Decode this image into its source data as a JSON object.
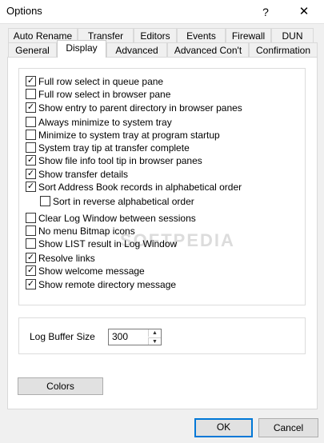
{
  "window": {
    "title": "Options",
    "help": "?",
    "close": "✕"
  },
  "tabs_row1": [
    "Auto Rename",
    "Transfer",
    "Editors",
    "Events",
    "Firewall",
    "DUN"
  ],
  "tabs_row2": [
    "General",
    "Display",
    "Advanced",
    "Advanced Con't",
    "Confirmation"
  ],
  "active_tab": "Display",
  "options": [
    {
      "label": "Full row select in queue pane",
      "checked": true
    },
    {
      "label": "Full row select in browser pane",
      "checked": false
    },
    {
      "label": "Show entry to parent directory in browser panes",
      "checked": true
    },
    {
      "label": "Always minimize to system tray",
      "checked": false
    },
    {
      "label": "Minimize to system tray at program startup",
      "checked": false
    },
    {
      "label": "System tray tip at transfer complete",
      "checked": false
    },
    {
      "label": "Show file info tool tip in browser panes",
      "checked": true
    },
    {
      "label": "Show transfer details",
      "checked": true
    },
    {
      "label": "Sort Address Book records in alphabetical order",
      "checked": true
    },
    {
      "label": "Sort in reverse alphabetical order",
      "checked": false
    },
    {
      "label": "Clear Log Window between sessions",
      "checked": false
    },
    {
      "label": "No menu Bitmap icons",
      "checked": false
    },
    {
      "label": "Show LIST result in Log Window",
      "checked": false
    },
    {
      "label": "Resolve links",
      "checked": true
    },
    {
      "label": "Show welcome message",
      "checked": true
    },
    {
      "label": "Show remote directory message",
      "checked": true
    }
  ],
  "watermark": "SOFTPEDIA",
  "log_buffer": {
    "label": "Log Buffer Size",
    "value": "300"
  },
  "buttons": {
    "colors": "Colors",
    "ok": "OK",
    "cancel": "Cancel"
  }
}
